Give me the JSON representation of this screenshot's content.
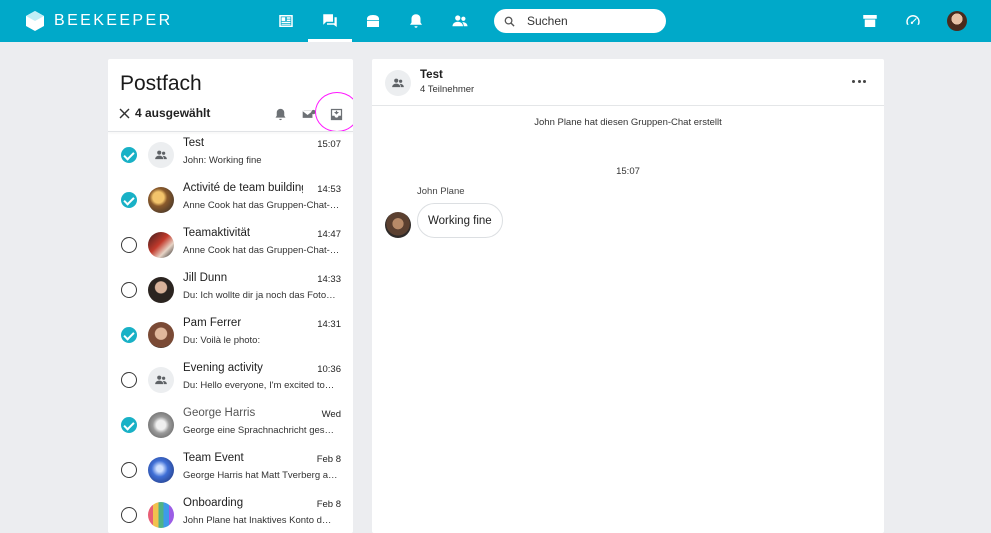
{
  "brand": {
    "name": "BEEKEEPER"
  },
  "nav": {
    "items": [
      {
        "icon": "news-feed-icon"
      },
      {
        "icon": "chat-icon",
        "active": true
      },
      {
        "icon": "store-icon"
      },
      {
        "icon": "bell-icon"
      },
      {
        "icon": "people-icon"
      }
    ],
    "search_placeholder": "Suchen",
    "right_items": [
      "tool-icon",
      "dashboard-icon"
    ]
  },
  "inbox": {
    "title": "Postfach",
    "selected_count_label": "4 ausgewählt",
    "conversations": [
      {
        "name": "Test",
        "time": "15:07",
        "preview": "John: Working fine",
        "checked": true,
        "avatar": "group"
      },
      {
        "name": "Activité de team building",
        "time": "14:53",
        "preview": "Anne Cook hat das Gruppen-Chat-…",
        "checked": true,
        "avatar": "photo-warm"
      },
      {
        "name": "Teamaktivität",
        "time": "14:47",
        "preview": "Anne Cook hat das Gruppen-Chat-…",
        "checked": false,
        "avatar": "photo-red"
      },
      {
        "name": "Jill Dunn",
        "time": "14:33",
        "preview": "Du: Ich wollte dir ja noch das Foto…",
        "checked": false,
        "avatar": "photo-person"
      },
      {
        "name": "Pam Ferrer",
        "time": "14:31",
        "preview": "Du: Voilà le photo:",
        "checked": true,
        "avatar": "photo-woman"
      },
      {
        "name": "Evening activity",
        "time": "10:36",
        "preview": "Du: Hello everyone, I'm excited to…",
        "checked": false,
        "avatar": "group"
      },
      {
        "name": "George Harris",
        "time": "Wed",
        "preview": "George eine Sprachnachricht ges…",
        "checked": true,
        "avatar": "photo-grey"
      },
      {
        "name": "Team Event",
        "time": "Feb 8",
        "preview": "George Harris hat Matt Tverberg a…",
        "checked": false,
        "avatar": "photo-blue"
      },
      {
        "name": "Onboarding",
        "time": "Feb 8",
        "preview": "John Plane hat Inaktives Konto d…",
        "checked": false,
        "avatar": "photo-colorful"
      }
    ]
  },
  "chat": {
    "title": "Test",
    "subtitle": "4 Teilnehmer",
    "system_message": "John Plane hat diesen Gruppen-Chat erstellt",
    "timestamp": "15:07",
    "sender": "John Plane",
    "message": "Working fine"
  },
  "colors": {
    "topbar": "#00a9c9",
    "accent": "#19b1c6",
    "highlight": "#ff19ff",
    "background": "#ecedf0"
  }
}
